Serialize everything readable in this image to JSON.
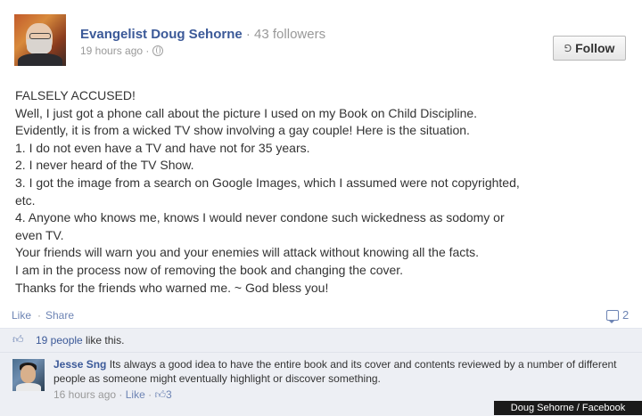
{
  "post": {
    "author": "Evangelist Doug Sehorne",
    "followers": "· 43 followers",
    "timestamp": "19 hours ago ·",
    "follow_label": "Follow",
    "follow_icon": "rss-icon",
    "body_lines": [
      "FALSELY ACCUSED!",
      "Well, I just got a phone call about the picture I used on my Book on Child Discipline.",
      "Evidently, it is from a wicked TV show involving a gay couple! Here is the situation.",
      "1. I do not even have a TV and have not for 35 years.",
      "2. I never heard of the TV Show.",
      "3. I got the image from a search on Google Images, which I assumed were not copyrighted,",
      "etc.",
      "4. Anyone who knows me, knows I would never condone such wickedness as sodomy or",
      "even TV.",
      "Your friends will warn you and your enemies will attack without knowing all the facts.",
      "I am in the process now of removing the book and changing the cover.",
      "Thanks for the friends who warned me. ~ God bless you!"
    ]
  },
  "actions": {
    "like_label": "Like",
    "separator": "·",
    "share_label": "Share",
    "comment_count": "2"
  },
  "likes": {
    "count_label": "19 people",
    "suffix": " like this."
  },
  "comment": {
    "author": "Jesse Sng",
    "text": "Its always a good idea to have the entire book and its cover and contents reviewed by a number of different people as someone might eventually highlight or discover something.",
    "timestamp": "16 hours ago ·",
    "like_label": "Like",
    "like_separator": " ·",
    "likes_count": "3"
  },
  "watermark": "Doug Sehorne / Facebook",
  "colors": {
    "link": "#3b5998",
    "muted_link": "#6d84b4",
    "panel_bg": "#edeff4"
  }
}
